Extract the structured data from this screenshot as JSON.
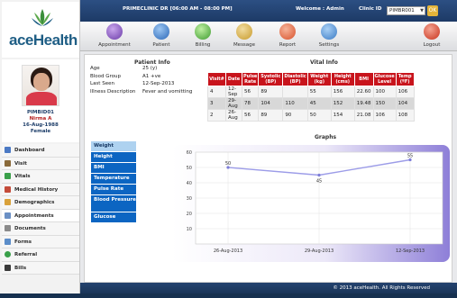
{
  "header": {
    "title": "PRIMECLINIC DR [06:00 AM - 08:00 PM]",
    "welcome": "Welcome : Admin",
    "clinic_label": "Clinic ID",
    "clinic_id": "PIMBR001",
    "go_label": "OK"
  },
  "brand": {
    "name": "aceHealth"
  },
  "toolbar": {
    "items": [
      "Appointment",
      "Patient",
      "Billing",
      "Message",
      "Report",
      "Settings"
    ],
    "logout": "Logout"
  },
  "patient": {
    "id": "PIMBID01",
    "name": "Nirma A",
    "dob": "16-Aug-1988",
    "gender": "Female"
  },
  "nav": {
    "items": [
      "Dashboard",
      "Visit",
      "Vitals",
      "Medical History",
      "Demographics",
      "Appointments",
      "Documents",
      "Forms",
      "Referral",
      "Bills"
    ]
  },
  "patient_info": {
    "heading": "Patient Info",
    "rows": [
      {
        "k": "Age",
        "v": "25 (y)"
      },
      {
        "k": "Blood Group",
        "v": "A1 +ve"
      },
      {
        "k": "Last Seen",
        "v": "12-Sep-2013"
      },
      {
        "k": "Illness Description",
        "v": "Fever and vomitting"
      }
    ]
  },
  "vital_info": {
    "heading": "Vital Info",
    "headers": [
      "Visit#",
      "Date",
      "Pulse Rate",
      "Systolic (BP)",
      "Diastolic (BP)",
      "Weight (kg)",
      "Height (cms)",
      "BMI",
      "Glucose Level",
      "Temp (ºF)"
    ],
    "rows": [
      [
        "4",
        "12-Sep",
        "56",
        "89",
        "",
        "55",
        "156",
        "22.60",
        "100",
        "106"
      ],
      [
        "3",
        "29-Aug",
        "78",
        "104",
        "110",
        "45",
        "152",
        "19.48",
        "150",
        "104"
      ],
      [
        "2",
        "26-Aug",
        "56",
        "89",
        "90",
        "50",
        "154",
        "21.08",
        "106",
        "108"
      ]
    ]
  },
  "graphs": {
    "heading": "Graphs",
    "tabs": [
      "Weight",
      "Height",
      "BMI",
      "Temperature",
      "Pulse Rate",
      "Blood Pressure",
      "Glucose"
    ],
    "active": "Weight"
  },
  "chart_data": {
    "type": "line",
    "categories": [
      "26-Aug-2013",
      "29-Aug-2013",
      "12-Sep-2013"
    ],
    "values": [
      50,
      45,
      55
    ],
    "ylim": [
      0,
      60
    ],
    "yticks": [
      10,
      20,
      30,
      40,
      50,
      60
    ],
    "title": "",
    "xlabel": "",
    "ylabel": "",
    "grid": true,
    "line_color": "#9c9ce8"
  },
  "footer": {
    "copyright": "© 2013 aceHealth. All Rights Reserved"
  }
}
